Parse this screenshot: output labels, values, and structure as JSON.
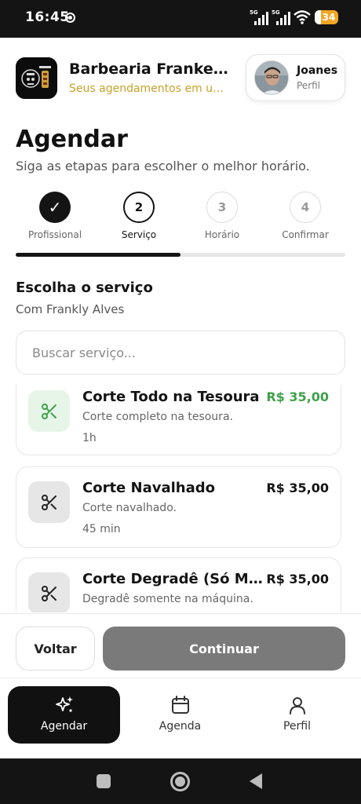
{
  "status_bar": {
    "time": "16:45",
    "net_label_1": "5G",
    "net_label_2": "5G",
    "battery": "34"
  },
  "header": {
    "shop_name": "Barbearia Frankenst...",
    "shop_subtitle": "Seus agendamentos em um s...",
    "user_name": "Joanes",
    "user_subtitle": "Perfil",
    "logo_icon": "barbershop-logo",
    "avatar_icon": "user-avatar-photo"
  },
  "page": {
    "title": "Agendar",
    "subtitle": "Siga as etapas para escolher o melhor horário."
  },
  "stepper": {
    "progress_fraction": 0.5,
    "steps": [
      {
        "label": "Profissional",
        "number": "✓",
        "state": "done"
      },
      {
        "label": "Serviço",
        "number": "2",
        "state": "active"
      },
      {
        "label": "Horário",
        "number": "3",
        "state": "pending"
      },
      {
        "label": "Confirmar",
        "number": "4",
        "state": "pending"
      }
    ]
  },
  "section": {
    "title": "Escolha o serviço",
    "subtitle": "Com Frankly Alves",
    "search_placeholder": "Buscar serviço..."
  },
  "services": [
    {
      "title": "Corte Todo na Tesoura",
      "description": "Corte completo na tesoura.",
      "duration": "1h",
      "price": "R$ 35,00",
      "selected": true,
      "icon": "scissors-icon"
    },
    {
      "title": "Corte Navalhado",
      "description": "Corte navalhado.",
      "duration": "45 min",
      "price": "R$ 35,00",
      "selected": false,
      "icon": "scissors-icon"
    },
    {
      "title": "Corte Degradê (Só Máquina)",
      "description": "Degradê somente na máquina.",
      "duration": "",
      "price": "R$ 35,00",
      "selected": false,
      "icon": "scissors-icon"
    }
  ],
  "actions": {
    "back_label": "Voltar",
    "continue_label": "Continuar"
  },
  "bottom_nav": [
    {
      "label": "Agendar",
      "icon": "sparkle-icon",
      "active": true
    },
    {
      "label": "Agenda",
      "icon": "calendar-icon",
      "active": false
    },
    {
      "label": "Perfil",
      "icon": "user-icon",
      "active": false
    }
  ],
  "colors": {
    "accent_gold": "#c7a228",
    "success_green": "#3fa24a",
    "dark": "#141414",
    "disabled_button": "#7a7a7a"
  }
}
